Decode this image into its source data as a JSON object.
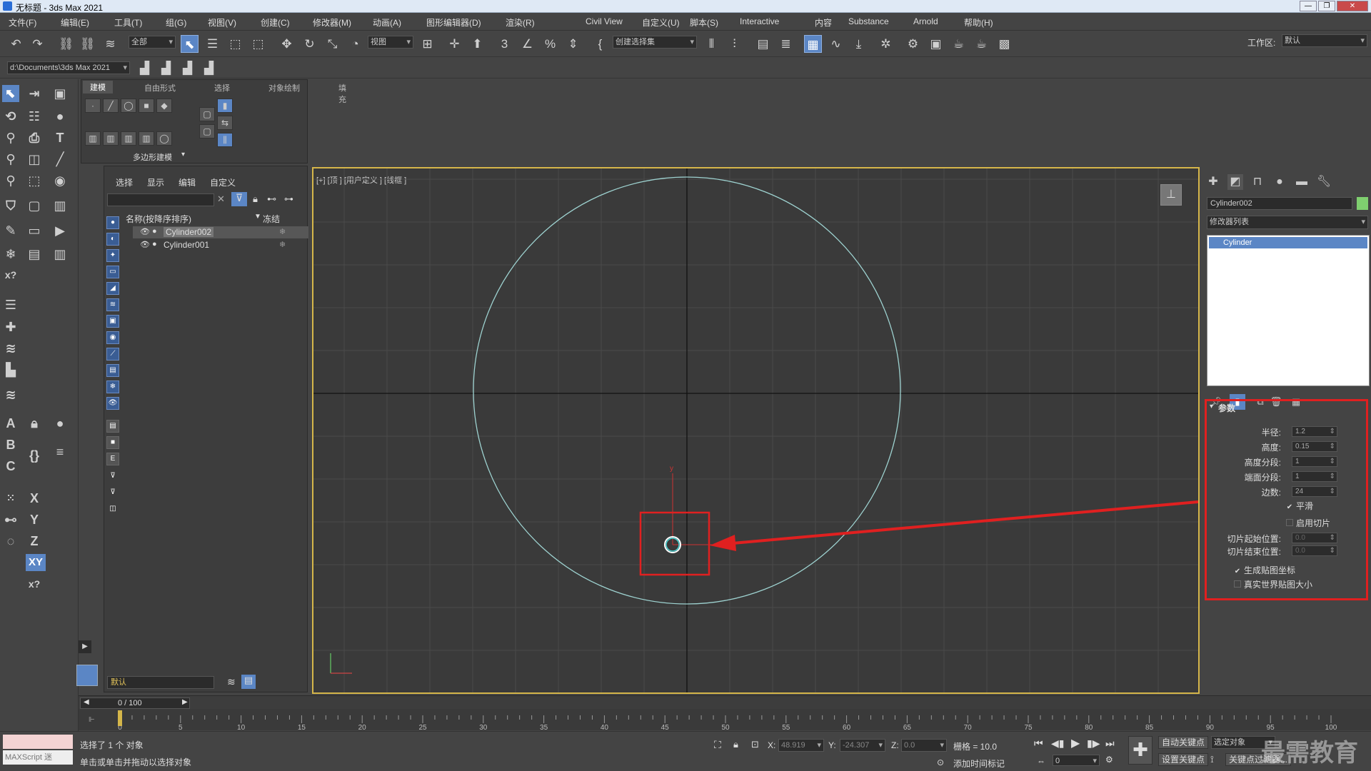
{
  "app": {
    "title": "无标题 - 3ds Max 2021"
  },
  "menu": [
    "文件(F)",
    "编辑(E)",
    "工具(T)",
    "组(G)",
    "视图(V)",
    "创建(C)",
    "修改器(M)",
    "动画(A)",
    "图形编辑器(D)",
    "渲染(R)",
    "Civil View",
    "自定义(U)",
    "脚本(S)",
    "Interactive",
    "内容",
    "Substance",
    "Arnold",
    "帮助(H)"
  ],
  "workspace": {
    "label": "工作区:",
    "value": "默认"
  },
  "toolbar": {
    "selection_filter": "全部",
    "ref_coord": "视图",
    "named_selection": "创建选择集",
    "project_path": "d:\\Documents\\3ds Max 2021",
    "snap_label": "3",
    "percent_label": "%"
  },
  "ribbon": {
    "tabs": [
      "建模",
      "自由形式",
      "选择",
      "对象绘制",
      "填充"
    ],
    "group": "多边形建模"
  },
  "scene_explorer": {
    "tabs": [
      "选择",
      "显示",
      "编辑",
      "自定义"
    ],
    "col_name": "名称(按降序排序)",
    "col_frozen": "冻结",
    "items": [
      {
        "name": "Cylinder002",
        "selected": true
      },
      {
        "name": "Cylinder001",
        "selected": false
      }
    ],
    "layer": "默认"
  },
  "viewport": {
    "label": "[+] [顶 ] [用户定义 ] [线框 ]",
    "accent": "#d5b64a"
  },
  "command_panel": {
    "object_name": "Cylinder002",
    "object_color": "#7fcf6f",
    "modifier_list": "修改器列表",
    "stack_item": "Cylinder",
    "rollout_title": "参数",
    "params": [
      {
        "label": "半径:",
        "value": "1.2"
      },
      {
        "label": "高度:",
        "value": "0.15"
      },
      {
        "label": "高度分段:",
        "value": "1"
      },
      {
        "label": "端面分段:",
        "value": "1"
      },
      {
        "label": "边数:",
        "value": "24"
      }
    ],
    "smooth": {
      "label": "平滑",
      "checked": true
    },
    "slice_on": {
      "label": "启用切片",
      "checked": false
    },
    "slice_from": {
      "label": "切片起始位置:",
      "value": "0.0"
    },
    "slice_to": {
      "label": "切片结束位置:",
      "value": "0.0"
    },
    "gen_mapping": {
      "label": "生成贴图坐标",
      "checked": true
    },
    "real_world": {
      "label": "真实世界贴图大小",
      "checked": false
    },
    "highlight_color": "#e02020"
  },
  "timeline": {
    "frame_display": "0 / 100",
    "ticks": [
      "0",
      "5",
      "10",
      "15",
      "20",
      "25",
      "30",
      "35",
      "40",
      "45",
      "50",
      "55",
      "60",
      "65",
      "70",
      "75",
      "80",
      "85",
      "90",
      "95",
      "100"
    ]
  },
  "status": {
    "maxscript": "MAXScript 迷",
    "line1": "选择了 1 个 对象",
    "line2": "单击或单击并拖动以选择对象",
    "x_label": "X:",
    "x": "48.919",
    "y_label": "Y:",
    "y": "-24.307",
    "z_label": "Z:",
    "z": "0.0",
    "grid": "栅格 = 10.0",
    "add_time_tag": "添加时间标记",
    "auto_key": "自动关键点",
    "set_key": "设置关键点",
    "selected_obj": "选定对象",
    "key_filters": "关键点过滤器...",
    "frame_value": "0",
    "watermark": "最需教育"
  }
}
